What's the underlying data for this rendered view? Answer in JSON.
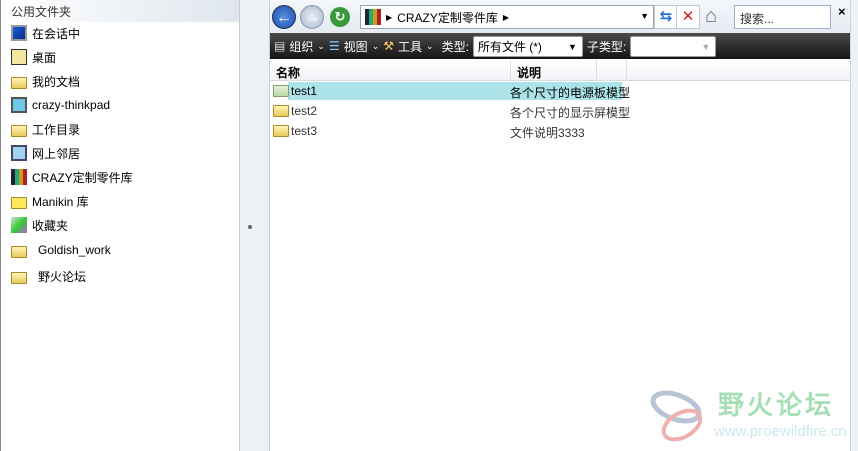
{
  "sidebar": {
    "title": "公用文件夹",
    "items": [
      {
        "label": "在会话中",
        "icon": "monitor-icon"
      },
      {
        "label": "桌面",
        "icon": "desktop-icon"
      },
      {
        "label": "我的文档",
        "icon": "documents-icon"
      },
      {
        "label": "crazy-thinkpad",
        "icon": "computer-icon"
      },
      {
        "label": "工作目录",
        "icon": "working-dir-icon"
      },
      {
        "label": "网上邻居",
        "icon": "network-icon"
      },
      {
        "label": "CRAZY定制零件库",
        "icon": "library-icon"
      },
      {
        "label": "Manikin 库",
        "icon": "manikin-library-icon"
      },
      {
        "label": "收藏夹",
        "icon": "favorites-icon"
      },
      {
        "label": "Goldish_work",
        "icon": "folder-icon"
      },
      {
        "label": "野火论坛",
        "icon": "folder-icon"
      }
    ]
  },
  "nav": {
    "path": "CRAZY定制零件库",
    "search_placeholder": "搜索...",
    "close": "×"
  },
  "toolbar": {
    "organize": "组织",
    "view": "视图",
    "tools": "工具",
    "type_label": "类型:",
    "type_value": "所有文件 (*)",
    "subtype_label": "子类型:",
    "subtype_value": ""
  },
  "columns": {
    "name": "名称",
    "desc": "说明"
  },
  "files": [
    {
      "name": "test1",
      "desc": "各个尺寸的电源板模型",
      "selected": true
    },
    {
      "name": "test2",
      "desc": "各个尺寸的显示屏模型",
      "selected": false
    },
    {
      "name": "test3",
      "desc": "文件说明3333",
      "selected": false
    }
  ],
  "watermark": {
    "title": "野火论坛",
    "url": "www.proewildfire.cn"
  },
  "colors": {
    "selection": "#abe3e8",
    "toolbar": "#1e1e1e"
  }
}
